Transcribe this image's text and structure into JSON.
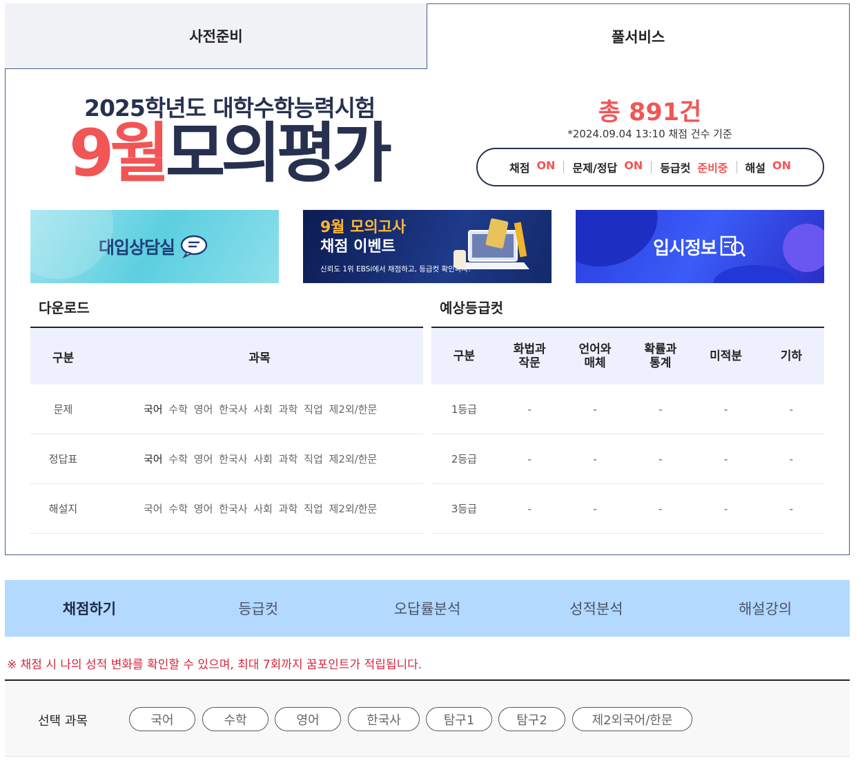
{
  "tabs": {
    "pre": "사전준비",
    "full": "풀서비스"
  },
  "hero": {
    "subtitle": "2025학년도 대학수학능력시험",
    "month": "9월",
    "title": "모의평가"
  },
  "stats": {
    "total": "총 891건",
    "note": "*2024.09.04 13:10 채점 건수 기준",
    "status": [
      {
        "label": "채점",
        "value": "ON"
      },
      {
        "label": "문제/정답",
        "value": "ON"
      },
      {
        "label": "등급컷",
        "value": "준비중"
      },
      {
        "label": "해설",
        "value": "ON"
      }
    ]
  },
  "banners": {
    "consult": "대입상담실",
    "event_line1": "9월 모의고사",
    "event_line2": "채점 이벤트",
    "event_sub": "신뢰도 1위 EBSi에서 채점하고, 등급컷 확인하자!",
    "info": "입시정보"
  },
  "download": {
    "title": "다운로드",
    "headers": [
      "구분",
      "과목"
    ],
    "rows": [
      {
        "label": "문제",
        "subjects": [
          "국어",
          "수학",
          "영어",
          "한국사",
          "사회",
          "과학",
          "직업",
          "제2외/한문"
        ]
      },
      {
        "label": "정답표",
        "subjects": [
          "국어",
          "수학",
          "영어",
          "한국사",
          "사회",
          "과학",
          "직업",
          "제2외/한문"
        ]
      },
      {
        "label": "해설지",
        "subjects": [
          "국어",
          "수학",
          "영어",
          "한국사",
          "사회",
          "과학",
          "직업",
          "제2외/한문"
        ]
      }
    ]
  },
  "gradecut": {
    "title": "예상등급컷",
    "headers": [
      "구분",
      "화법과\n작문",
      "언어와\n매체",
      "확률과\n통계",
      "미적분",
      "기하"
    ],
    "rows": [
      [
        "1등급",
        "-",
        "-",
        "-",
        "-",
        "-"
      ],
      [
        "2등급",
        "-",
        "-",
        "-",
        "-",
        "-"
      ],
      [
        "3등급",
        "-",
        "-",
        "-",
        "-",
        "-"
      ]
    ]
  },
  "bottom_nav": [
    "채점하기",
    "등급컷",
    "오답률분석",
    "성적분석",
    "해설강의"
  ],
  "notice": "※ 채점 시 나의 성적 변화를 확인할 수 있으며, 최대 7회까지 꿈포인트가 적립됩니다.",
  "select": {
    "label": "선택 과목",
    "chips": [
      "국어",
      "수학",
      "영어",
      "한국사",
      "탐구1",
      "탐구2",
      "제2외국어/한문"
    ]
  },
  "colors": {
    "accent_red": "#f25555",
    "navy": "#27304f",
    "nav_bg": "#b3d9ff",
    "notice_red": "#d6253d"
  }
}
